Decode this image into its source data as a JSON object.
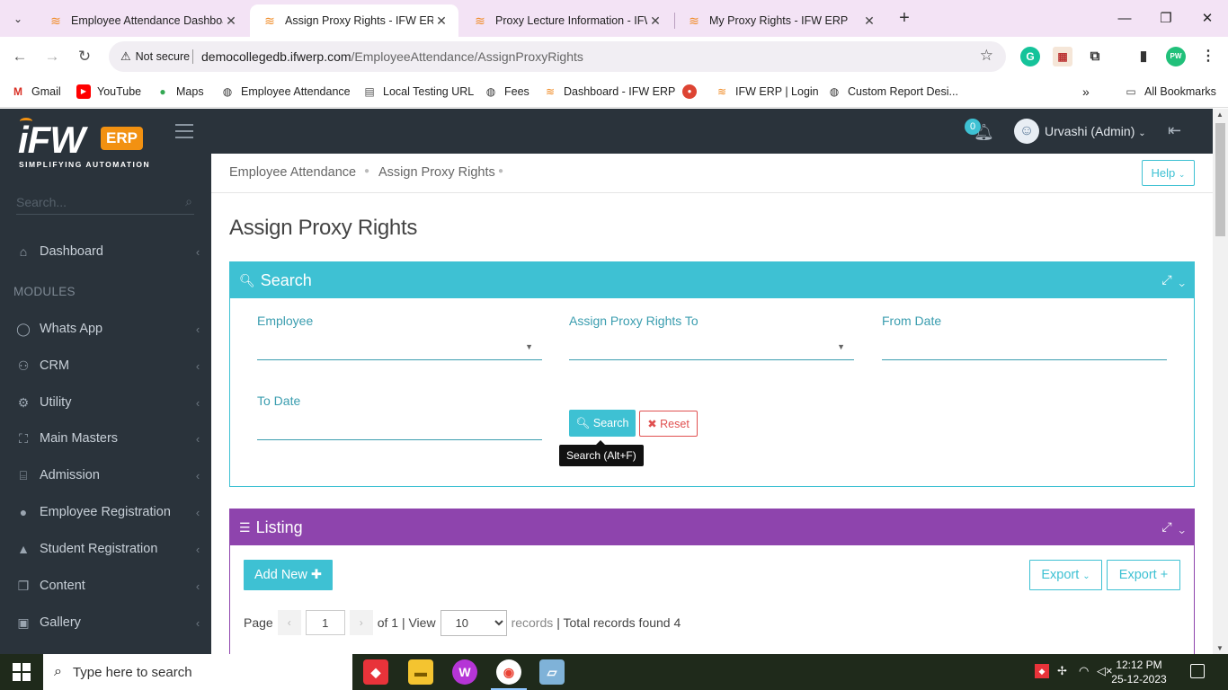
{
  "browser": {
    "tabs": [
      {
        "title": "Employee Attendance Dashboard",
        "active": false
      },
      {
        "title": "Assign Proxy Rights - IFW ERP",
        "active": true
      },
      {
        "title": "Proxy Lecture Information - IFW",
        "active": false
      },
      {
        "title": "My Proxy Rights - IFW ERP",
        "active": false
      }
    ],
    "security_label": "Not secure",
    "url_domain": "democollegedb.ifwerp.com",
    "url_path": "/EmployeeAttendance/AssignProxyRights",
    "bookmarks": [
      "Gmail",
      "YouTube",
      "Maps",
      "Employee Attendance",
      "Local Testing URL",
      "Fees",
      "Dashboard - IFW ERP",
      "IFW ERP | Login",
      "Custom Report Desi..."
    ],
    "all_bookmarks": "All Bookmarks"
  },
  "sidebar": {
    "logo_text": "iFW",
    "logo_badge": "ERP",
    "logo_tagline": "SIMPLIFYING AUTOMATION",
    "search_placeholder": "Search...",
    "modules_label": "MODULES",
    "items": [
      {
        "label": "Dashboard",
        "icon": "home-icon"
      },
      {
        "label": "Whats App",
        "icon": "whatsapp-icon"
      },
      {
        "label": "CRM",
        "icon": "users-icon"
      },
      {
        "label": "Utility",
        "icon": "cogs-icon"
      },
      {
        "label": "Main Masters",
        "icon": "sitemap-icon"
      },
      {
        "label": "Admission",
        "icon": "institution-icon"
      },
      {
        "label": "Employee Registration",
        "icon": "user-icon"
      },
      {
        "label": "Student Registration",
        "icon": "graduation-cap-icon"
      },
      {
        "label": "Content",
        "icon": "copy-icon"
      },
      {
        "label": "Gallery",
        "icon": "image-icon"
      }
    ]
  },
  "topbar": {
    "notification_count": "0",
    "user_name": "Urvashi (Admin)"
  },
  "breadcrumb": {
    "items": [
      "Employee Attendance",
      "Assign Proxy Rights"
    ],
    "help_label": "Help"
  },
  "page": {
    "title": "Assign Proxy Rights"
  },
  "search_panel": {
    "title": "Search",
    "employee_label": "Employee",
    "assign_to_label": "Assign Proxy Rights To",
    "from_date_label": "From Date",
    "to_date_label": "To Date",
    "search_button": "Search",
    "reset_button": "Reset",
    "tooltip": "Search (Alt+F)"
  },
  "listing_panel": {
    "title": "Listing",
    "add_new_button": "Add New",
    "export_dropdown": "Export",
    "export_plus": "Export +",
    "page_label": "Page",
    "current_page": "1",
    "of_pages": "of 1 | View",
    "page_size": "10",
    "records_label": "records",
    "total_records": "| Total records found 4"
  },
  "taskbar": {
    "search_placeholder": "Type here to search",
    "time": "12:12 PM",
    "date": "25-12-2023"
  }
}
